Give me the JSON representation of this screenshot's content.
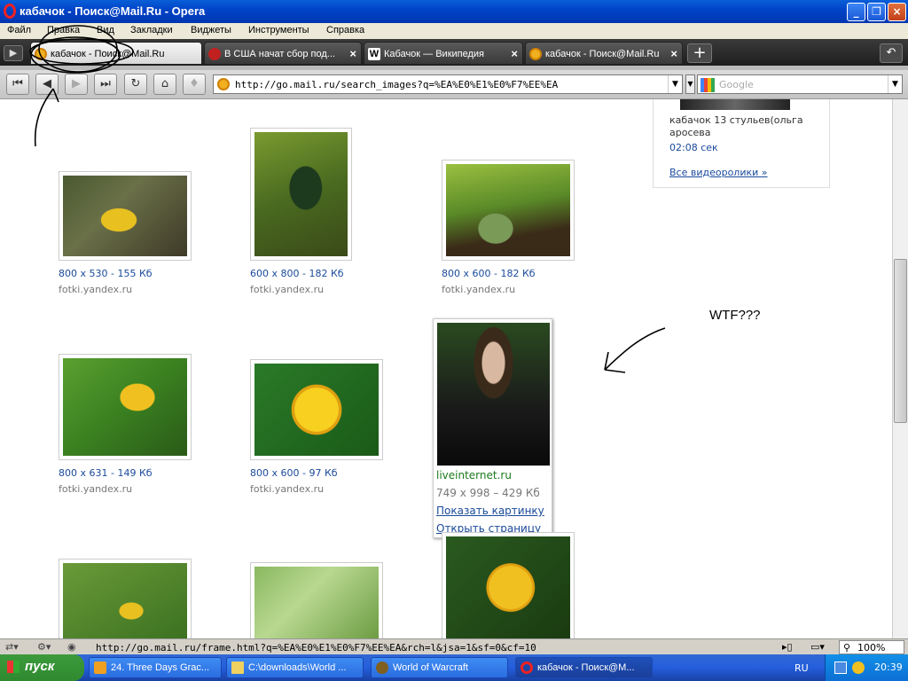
{
  "window": {
    "title": "кабачок - Поиск@Mail.Ru - Opera",
    "min": "_",
    "max": "❐",
    "close": "×"
  },
  "menu": [
    "Файл",
    "Правка",
    "Вид",
    "Закладки",
    "Виджеты",
    "Инструменты",
    "Справка"
  ],
  "tabs": [
    {
      "label": "кабачок - Поиск@Mail.Ru",
      "active": true,
      "close": "×"
    },
    {
      "label": "В США начат сбор под...",
      "active": false,
      "close": "×"
    },
    {
      "label": "Кабачок — Википедия",
      "active": false,
      "close": "×"
    },
    {
      "label": "кабачок - Поиск@Mail.Ru",
      "active": false,
      "close": "×"
    }
  ],
  "nav": {
    "url": "http://go.mail.ru/search_images?q=%EA%E0%E1%E0%F7%EE%EA",
    "search_placeholder": "Google"
  },
  "video_panel": {
    "caption_line1": "кабачок 13 стульев(ольга",
    "caption_line2": "аросева",
    "duration": "02:08 сек",
    "all_videos": "Все видеоролики  »"
  },
  "results": [
    {
      "caption": "800 x 530 - 155 Кб",
      "source": "fotki.yandex.ru"
    },
    {
      "caption": "600 x 800 - 182 Кб",
      "source": "fotki.yandex.ru"
    },
    {
      "caption": "800 x 600 - 182 Кб",
      "source": "fotki.yandex.ru"
    },
    {
      "caption": "800 x 631 - 149 Кб",
      "source": "fotki.yandex.ru"
    },
    {
      "caption": "800 x 600 - 97 Кб",
      "source": "fotki.yandex.ru"
    }
  ],
  "hover_card": {
    "source": "liveinternet.ru",
    "size": "749 x 998 – 429 Кб",
    "show_image": "Показать картинку",
    "open_page": "Открыть страницу"
  },
  "annotation": {
    "text": "WTF???"
  },
  "status": {
    "url": "http://go.mail.ru/frame.html?q=%EA%E0%E1%E0%F7%EE%EA&rch=l&jsa=1&sf=0&cf=10",
    "zoom": "100%"
  },
  "taskbar": {
    "start": "пуск",
    "items": [
      {
        "label": "24. Three Days Grac..."
      },
      {
        "label": "C:\\downloads\\World ..."
      },
      {
        "label": "World of Warcraft"
      },
      {
        "label": "кабачок - Поиск@M...",
        "active": true
      }
    ],
    "lang": "RU",
    "time": "20:39"
  },
  "colors": {
    "title_bar": "#0044c8",
    "link": "#1a4a9a",
    "green_link": "#1c7a1c"
  }
}
